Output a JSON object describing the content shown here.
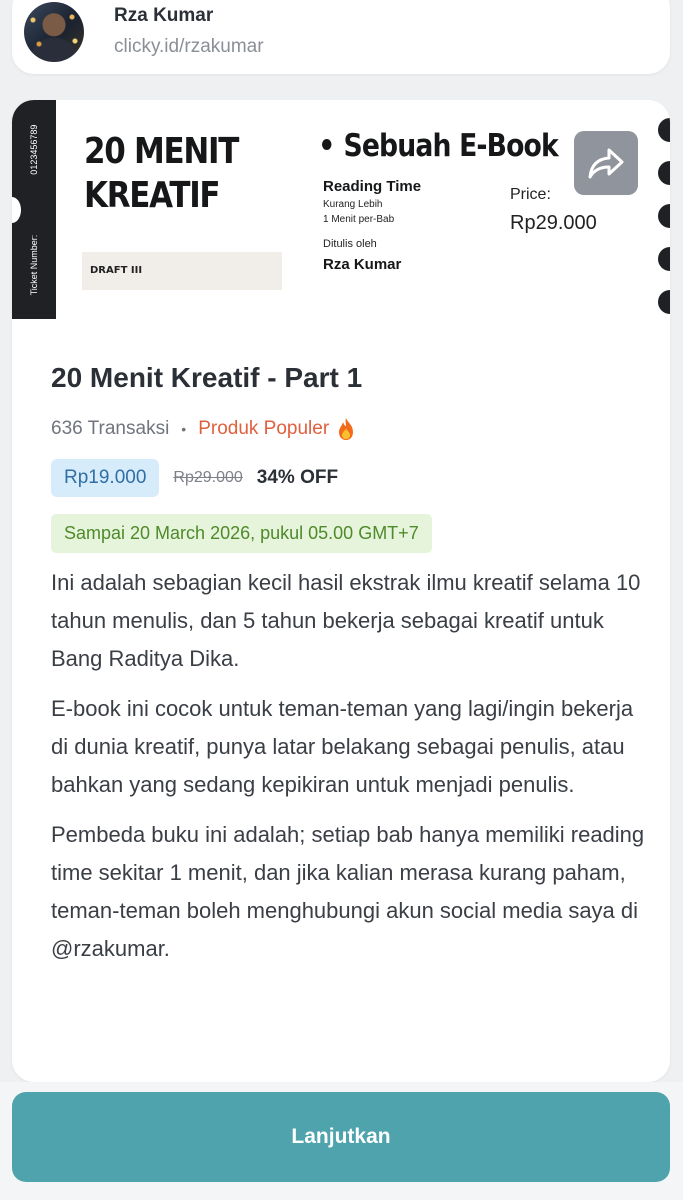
{
  "profile": {
    "name": "Rza Kumar",
    "url": "clicky.id/rzakumar"
  },
  "ticket": {
    "ticket_number": "0123456789",
    "ticket_label": "Ticket Number:",
    "title_line1": "20 MENIT",
    "title_line2": "KREATIF",
    "draft": "DRAFT III",
    "ebook_heading": "Sebuah E-Book",
    "reading_time_title": "Reading Time",
    "reading_time_line1": "Kurang Lebih",
    "reading_time_line2": "1 Menit per-Bab",
    "written_by_label": "Ditulis oleh",
    "author": "Rza Kumar",
    "price_label": "Price:",
    "price_value": "Rp29.000",
    "share_icon": "share-arrow-icon"
  },
  "product": {
    "title": "20 Menit Kreatif - Part 1",
    "transactions": "636 Transaksi",
    "separator": "•",
    "popular_label": "Produk Populer",
    "popular_icon": "fire-icon",
    "price": "Rp19.000",
    "old_price": "Rp29.000",
    "discount": "34% OFF",
    "deadline": "Sampai 20 March 2026, pukul 05.00 GMT+7",
    "description": [
      "Ini adalah sebagian kecil hasil ekstrak ilmu kreatif selama 10 tahun menulis, dan 5 tahun bekerja sebagai kreatif untuk Bang Raditya Dika.",
      "E-book ini cocok untuk teman-teman yang lagi/ingin bekerja di dunia kreatif, punya latar belakang sebagai penulis, atau bahkan yang sedang kepikiran untuk menjadi penulis.",
      "Pembeda buku ini adalah; setiap bab hanya memiliki reading time sekitar 1 menit, dan jika kalian merasa kurang paham, teman-teman boleh menghubungi akun social media saya di @rzakumar."
    ]
  },
  "cta": {
    "label": "Lanjutkan"
  },
  "colors": {
    "accent": "#4fa3ad",
    "popular": "#e0603e",
    "price_pill_bg": "#d7ecfb",
    "deadline_bg": "#e6f4dc",
    "deadline_text": "#4e8a2a"
  }
}
